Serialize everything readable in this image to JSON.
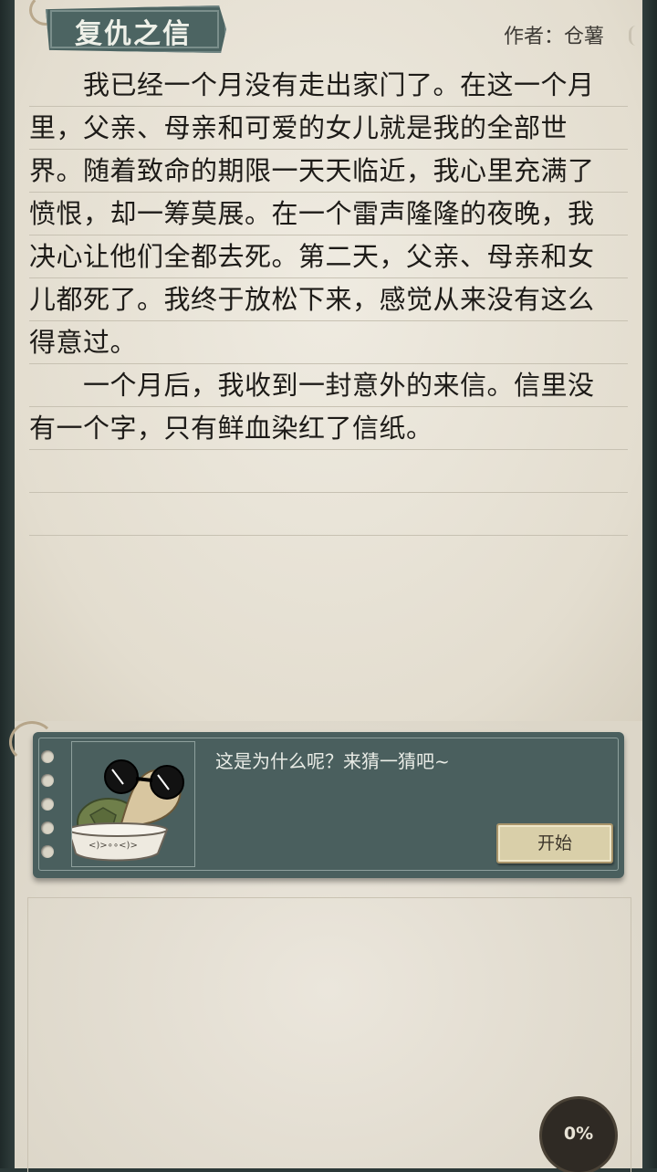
{
  "header": {
    "title": "复仇之信",
    "author": "作者：仓薯"
  },
  "story": {
    "lines": [
      "　　我已经一个月没有走出家门了。在这一个月",
      "里，父亲、母亲和可爱的女儿就是我的全部世",
      "界。随着致命的期限一天天临近，我心里充满了",
      "愤恨，却一筹莫展。在一个雷声隆隆的夜晚，我",
      "决心让他们全都去死。第二天，父亲、母亲和女",
      "儿都死了。我终于放松下来，感觉从来没有这么",
      "得意过。",
      "　　一个月后，我收到一封意外的来信。信里没",
      "有一个字，只有鲜血染红了信纸。"
    ]
  },
  "dialog": {
    "prompt": "这是为什么呢？来猜一猜吧~",
    "start_label": "开始"
  },
  "progress": {
    "label": "0%",
    "value": 0
  },
  "icons": {
    "avatar": "turtle-with-sunglasses-icon",
    "hook": "ring-hook-icon"
  },
  "colors": {
    "paper": "#ebe6da",
    "panel": "#4a5f5e",
    "banner": "#4c6462",
    "button": "#d9cfa9"
  }
}
